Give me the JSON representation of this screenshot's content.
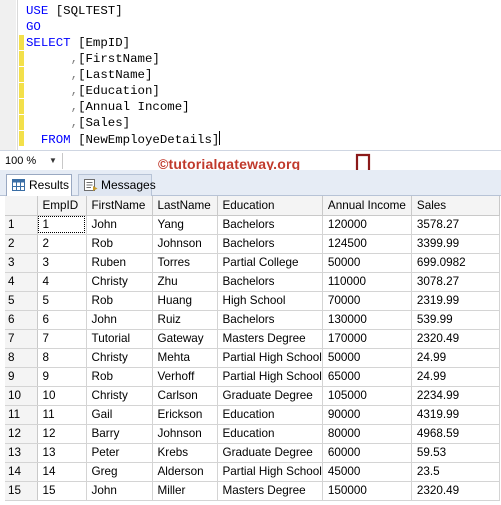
{
  "editor": {
    "lines": [
      [
        {
          "t": "USE ",
          "c": "kw"
        },
        {
          "t": "[SQLTEST]",
          "c": ""
        }
      ],
      [
        {
          "t": "GO",
          "c": "kw"
        }
      ],
      [
        {
          "t": "SELECT ",
          "c": "kw"
        },
        {
          "t": "[EmpID]",
          "c": ""
        }
      ],
      [
        {
          "t": "      ",
          "c": ""
        },
        {
          "t": ",",
          "c": "op"
        },
        {
          "t": "[FirstName]",
          "c": ""
        }
      ],
      [
        {
          "t": "      ",
          "c": ""
        },
        {
          "t": ",",
          "c": "op"
        },
        {
          "t": "[LastName]",
          "c": ""
        }
      ],
      [
        {
          "t": "      ",
          "c": ""
        },
        {
          "t": ",",
          "c": "op"
        },
        {
          "t": "[Education]",
          "c": ""
        }
      ],
      [
        {
          "t": "      ",
          "c": ""
        },
        {
          "t": ",",
          "c": "op"
        },
        {
          "t": "[Annual Income]",
          "c": ""
        }
      ],
      [
        {
          "t": "      ",
          "c": ""
        },
        {
          "t": ",",
          "c": "op"
        },
        {
          "t": "[Sales]",
          "c": ""
        }
      ],
      [
        {
          "t": "  FROM ",
          "c": "kw"
        },
        {
          "t": "[NewEmployeDetails]",
          "c": ""
        }
      ]
    ],
    "change_marker_color": "#f3e04a"
  },
  "zoom": {
    "value": "100 %"
  },
  "watermark": {
    "text": "©tutorialgateway.org",
    "color": "#c0392b"
  },
  "arrow": {
    "icon": "down-arrow-icon",
    "color": "#8b1a1a"
  },
  "tabs": [
    {
      "label": "Results",
      "icon": "grid-icon",
      "active": true
    },
    {
      "label": "Messages",
      "icon": "messages-icon",
      "active": false
    }
  ],
  "grid": {
    "columns": [
      "EmpID",
      "FirstName",
      "LastName",
      "Education",
      "Annual Income",
      "Sales"
    ],
    "rows": [
      [
        "1",
        "1",
        "John",
        "Yang",
        "Bachelors",
        "120000",
        "3578.27"
      ],
      [
        "2",
        "2",
        "Rob",
        "Johnson",
        "Bachelors",
        "124500",
        "3399.99"
      ],
      [
        "3",
        "3",
        "Ruben",
        "Torres",
        "Partial College",
        "50000",
        "699.0982"
      ],
      [
        "4",
        "4",
        "Christy",
        "Zhu",
        "Bachelors",
        "110000",
        "3078.27"
      ],
      [
        "5",
        "5",
        "Rob",
        "Huang",
        "High School",
        "70000",
        "2319.99"
      ],
      [
        "6",
        "6",
        "John",
        "Ruiz",
        "Bachelors",
        "130000",
        "539.99"
      ],
      [
        "7",
        "7",
        "Tutorial",
        "Gateway",
        "Masters Degree",
        "170000",
        "2320.49"
      ],
      [
        "8",
        "8",
        "Christy",
        "Mehta",
        "Partial High School",
        "50000",
        "24.99"
      ],
      [
        "9",
        "9",
        "Rob",
        "Verhoff",
        "Partial High School",
        "65000",
        "24.99"
      ],
      [
        "10",
        "10",
        "Christy",
        "Carlson",
        "Graduate Degree",
        "105000",
        "2234.99"
      ],
      [
        "11",
        "11",
        "Gail",
        "Erickson",
        "Education",
        "90000",
        "4319.99"
      ],
      [
        "12",
        "12",
        "Barry",
        "Johnson",
        "Education",
        "80000",
        "4968.59"
      ],
      [
        "13",
        "13",
        "Peter",
        "Krebs",
        "Graduate Degree",
        "60000",
        "59.53"
      ],
      [
        "14",
        "14",
        "Greg",
        "Alderson",
        "Partial High School",
        "45000",
        "23.5"
      ],
      [
        "15",
        "15",
        "John",
        "Miller",
        "Masters Degree",
        "150000",
        "2320.49"
      ]
    ]
  }
}
